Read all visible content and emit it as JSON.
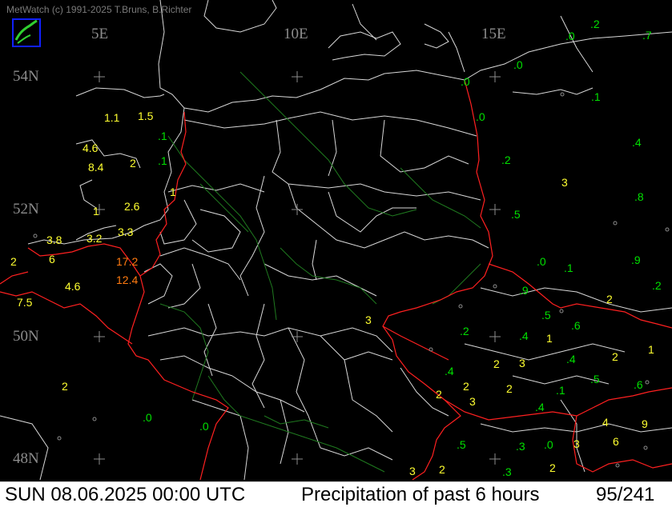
{
  "header": {
    "copyright": "MetWatch  (c) 1991-2025 T.Bruns, B.Richter"
  },
  "logo_name": "metwatch-logo",
  "grid": {
    "longitudes": [
      "5E",
      "10E",
      "15E"
    ],
    "latitudes": [
      "54N",
      "52N",
      "50N",
      "48N"
    ]
  },
  "colors": {
    "low": "#00e000",
    "mid": "#ffff30",
    "high": "#ff7a10",
    "border": "#ff2020",
    "region": "#d8d8d8",
    "river": "#1f7a1f",
    "marker": "#8c8c8c"
  },
  "observations": [
    {
      "v": "1.1",
      "c": "mid"
    },
    {
      "v": "1.5",
      "c": "mid"
    },
    {
      "v": ".1",
      "c": "low"
    },
    {
      "v": "4.6",
      "c": "mid"
    },
    {
      "v": "8.4",
      "c": "mid"
    },
    {
      "v": "2",
      "c": "mid"
    },
    {
      "v": ".1",
      "c": "low"
    },
    {
      "v": "1",
      "c": "mid"
    },
    {
      "v": "1",
      "c": "mid"
    },
    {
      "v": "2.6",
      "c": "mid"
    },
    {
      "v": "3.8",
      "c": "mid"
    },
    {
      "v": "3.2",
      "c": "mid"
    },
    {
      "v": "3.3",
      "c": "mid"
    },
    {
      "v": "2",
      "c": "mid"
    },
    {
      "v": "6",
      "c": "mid"
    },
    {
      "v": "17.2",
      "c": "high"
    },
    {
      "v": "12.4",
      "c": "high"
    },
    {
      "v": "4.6",
      "c": "mid"
    },
    {
      "v": "7.5",
      "c": "mid"
    },
    {
      "v": "2",
      "c": "mid"
    },
    {
      "v": ".0",
      "c": "low"
    },
    {
      "v": ".0",
      "c": "low"
    },
    {
      "v": "3",
      "c": "mid"
    },
    {
      "v": ".0",
      "c": "low"
    },
    {
      "v": ".2",
      "c": "low"
    },
    {
      "v": ".7",
      "c": "low"
    },
    {
      "v": ".0",
      "c": "low"
    },
    {
      "v": ".0",
      "c": "low"
    },
    {
      "v": ".0",
      "c": "low"
    },
    {
      "v": ".1",
      "c": "low"
    },
    {
      "v": ".4",
      "c": "low"
    },
    {
      "v": ".2",
      "c": "low"
    },
    {
      "v": "3",
      "c": "mid"
    },
    {
      "v": ".8",
      "c": "low"
    },
    {
      "v": ".5",
      "c": "low"
    },
    {
      "v": ".0",
      "c": "low"
    },
    {
      "v": ".1",
      "c": "low"
    },
    {
      "v": ".9",
      "c": "low"
    },
    {
      "v": ".2",
      "c": "low"
    },
    {
      "v": ".9",
      "c": "low"
    },
    {
      "v": "2",
      "c": "mid"
    },
    {
      "v": ".5",
      "c": "low"
    },
    {
      "v": ".6",
      "c": "low"
    },
    {
      "v": ".2",
      "c": "low"
    },
    {
      "v": ".4",
      "c": "low"
    },
    {
      "v": "1",
      "c": "mid"
    },
    {
      "v": "1",
      "c": "mid"
    },
    {
      "v": ".4",
      "c": "low"
    },
    {
      "v": "2",
      "c": "mid"
    },
    {
      "v": "2",
      "c": "mid"
    },
    {
      "v": "3",
      "c": "mid"
    },
    {
      "v": ".4",
      "c": "low"
    },
    {
      "v": "2",
      "c": "mid"
    },
    {
      "v": ".5",
      "c": "low"
    },
    {
      "v": ".6",
      "c": "low"
    },
    {
      "v": "2",
      "c": "mid"
    },
    {
      "v": "3",
      "c": "mid"
    },
    {
      "v": "2",
      "c": "mid"
    },
    {
      "v": ".1",
      "c": "low"
    },
    {
      "v": ".4",
      "c": "low"
    },
    {
      "v": "4",
      "c": "mid"
    },
    {
      "v": "9",
      "c": "mid"
    },
    {
      "v": ".5",
      "c": "low"
    },
    {
      "v": ".3",
      "c": "low"
    },
    {
      "v": ".0",
      "c": "low"
    },
    {
      "v": "3",
      "c": "mid"
    },
    {
      "v": "6",
      "c": "mid"
    },
    {
      "v": "3",
      "c": "mid"
    },
    {
      "v": "2",
      "c": "mid"
    },
    {
      "v": ".3",
      "c": "low"
    },
    {
      "v": "2",
      "c": "mid"
    }
  ],
  "status": {
    "datetime": "SUN 08.06.2025 00:00 UTC",
    "product": "Precipitation of past  6 hours",
    "count": "95/241"
  }
}
